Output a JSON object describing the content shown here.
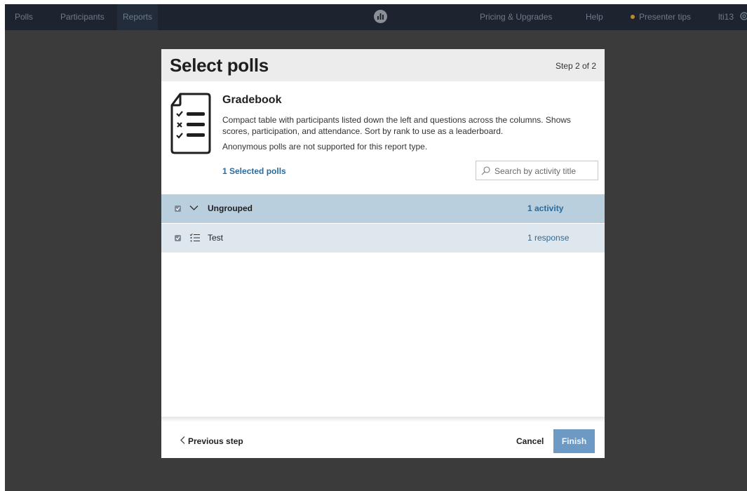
{
  "nav": {
    "left_items": [
      "Polls",
      "Participants",
      "Reports"
    ],
    "active": "Reports",
    "right_items": {
      "pricing": "Pricing & Upgrades",
      "help": "Help",
      "presenter_tips": "Presenter tips",
      "user": "lti13"
    },
    "logo_icon": "poll-everywhere-logo-icon",
    "settings_icon": "gear-icon",
    "tips_dot_color": "#b98a2a"
  },
  "modal": {
    "title": "Select polls",
    "step": "Step 2 of 2",
    "report": {
      "icon": "document-checklist-icon",
      "title": "Gradebook",
      "description": "Compact table with participants listed down the left and questions across the columns. Shows scores, participation, and attendance. Sort by rank to use as a leaderboard.",
      "note": "Anonymous polls are not supported for this report type."
    },
    "selected_count": "1 Selected polls",
    "search": {
      "placeholder": "Search by activity title",
      "value": ""
    },
    "groups": [
      {
        "label": "Ungrouped",
        "meta": "1 activity",
        "checked": true,
        "expanded": true,
        "items": [
          {
            "label": "Test",
            "meta": "1 response",
            "checked": true,
            "icon": "multiple-choice-list-icon"
          }
        ]
      }
    ],
    "footer": {
      "previous": "Previous step",
      "cancel": "Cancel",
      "finish": "Finish"
    }
  },
  "colors": {
    "accent": "#2b6a9a",
    "finish_button": "#6d9ac4",
    "group_row": "#b9cfde",
    "item_row": "#dfe7ee",
    "nav_bg": "#1d2430",
    "backdrop": "#3b3b3b"
  }
}
